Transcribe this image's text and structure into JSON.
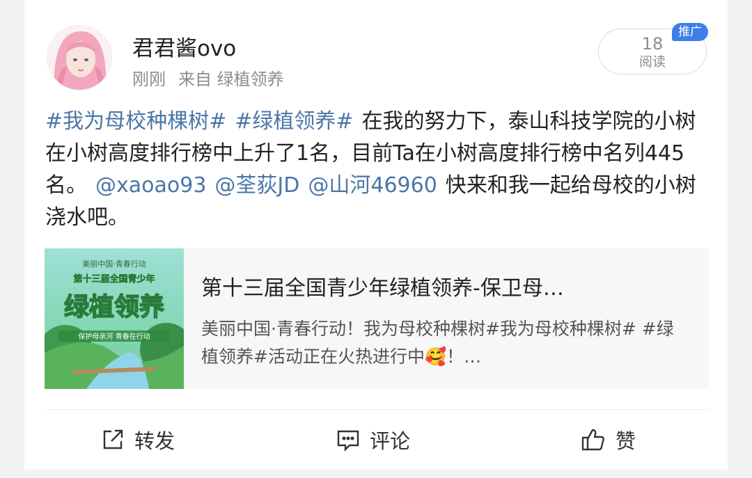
{
  "user": {
    "name": "君君酱ovo",
    "time": "刚刚",
    "source": "来自 绿植领养"
  },
  "reads": {
    "count": "18",
    "label": "阅读"
  },
  "promo_badge": "推广",
  "post": {
    "tag1": "#我为母校种棵树#",
    "tag2": "#绿植领养#",
    "text1": "在我的努力下，泰山科技学院的小树在小树高度排行榜中上升了1名，目前Ta在小树高度排行榜中名列445名。",
    "mention1": "@xaoao93",
    "mention2": "@荃荻JD",
    "mention3": "@山河46960",
    "text2": "快来和我一起给母校的小树浇水吧。"
  },
  "link_card": {
    "title": "第十三届全国青少年绿植领养-保卫母…",
    "description": "美丽中国·青春行动！我为母校种棵树#我为母校种棵树# #绿植领养#活动正在火热进行中🥰！…",
    "thumb_top": "美丽中国·青春行动",
    "thumb_banner": "第十三届全国青少年",
    "thumb_main": "绿植领养",
    "thumb_sub": "保护母亲河  青春在行动"
  },
  "actions": {
    "repost": "转发",
    "comment": "评论",
    "like": "赞"
  },
  "colors": {
    "link": "#4a76a8",
    "badge": "#3e7ee8",
    "meta": "#8c8c8c"
  }
}
